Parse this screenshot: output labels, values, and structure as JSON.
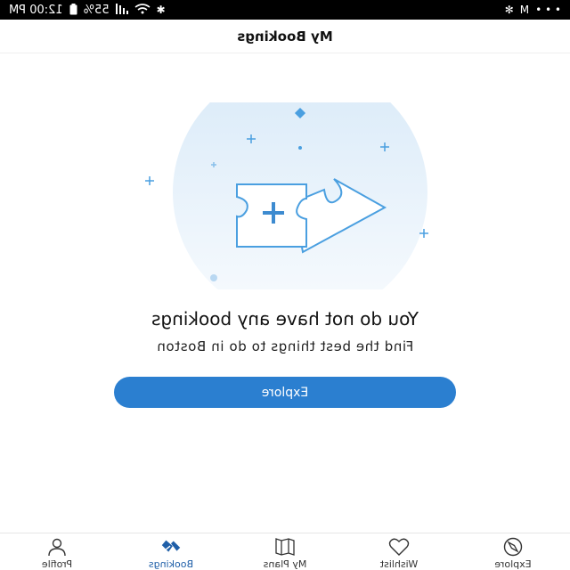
{
  "status_bar": {
    "time": "12:00 PM",
    "battery": "55%",
    "left_glyphs": "• • •",
    "app_letter": "M"
  },
  "header": {
    "title": "My Bookings"
  },
  "empty_state": {
    "title": "You do not have any bookings",
    "subtitle": "Find the best things to do in Boston",
    "button_label": "Explore"
  },
  "nav": {
    "items": [
      {
        "label": "Explore",
        "icon": "compass-icon"
      },
      {
        "label": "Wishlist",
        "icon": "heart-icon"
      },
      {
        "label": "My Plans",
        "icon": "map-icon"
      },
      {
        "label": "Bookings",
        "icon": "tickets-icon",
        "active": true
      },
      {
        "label": "Profile",
        "icon": "person-icon"
      }
    ]
  },
  "colors": {
    "accent": "#2b7fd0",
    "illustration": "#4a9fe0",
    "circle_bg": "#e6f1fb"
  }
}
